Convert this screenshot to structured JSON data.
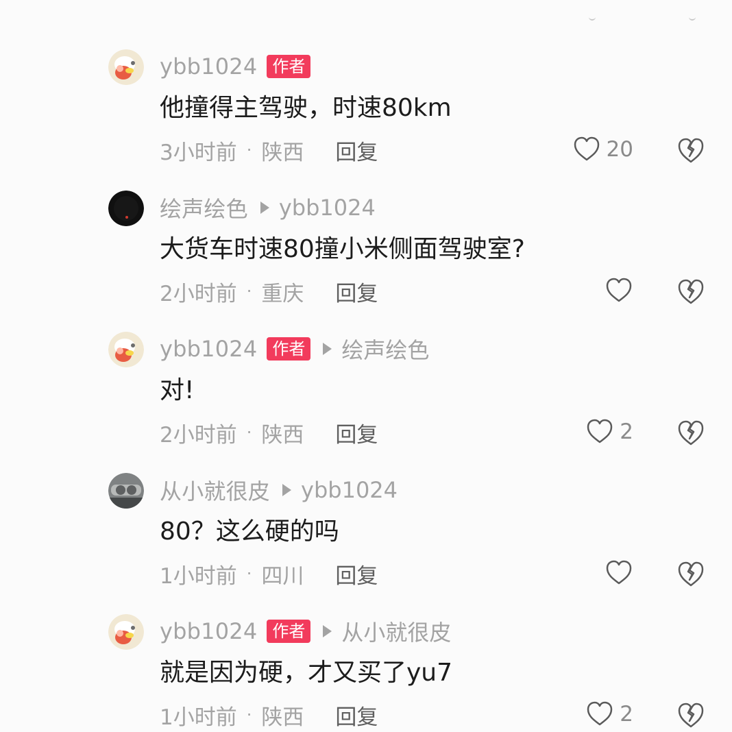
{
  "author_badge": "作者",
  "reply_label": "回复",
  "comments": [
    {
      "username": "ybb1024",
      "is_author": true,
      "reply_to": "",
      "text": "他撞得主驾驶，时速80km",
      "time": "3小时前",
      "location": "陕西",
      "likes": "20",
      "avatar": "cartoon-avatar"
    },
    {
      "username": "绘声绘色",
      "is_author": false,
      "reply_to": "ybb1024",
      "text": "大货车时速80撞小米侧面驾驶室?",
      "time": "2小时前",
      "location": "重庆",
      "likes": "",
      "avatar": "dark-avatar"
    },
    {
      "username": "ybb1024",
      "is_author": true,
      "reply_to": "绘声绘色",
      "text": "对!",
      "time": "2小时前",
      "location": "陕西",
      "likes": "2",
      "avatar": "cartoon-avatar"
    },
    {
      "username": "从小就很皮",
      "is_author": false,
      "reply_to": "ybb1024",
      "text": "80？这么硬的吗",
      "time": "1小时前",
      "location": "四川",
      "likes": "",
      "avatar": "gray-avatar"
    },
    {
      "username": "ybb1024",
      "is_author": true,
      "reply_to": "从小就很皮",
      "text": "就是因为硬，才又买了yu7",
      "time": "1小时前",
      "location": "陕西",
      "likes": "2",
      "avatar": "cartoon-avatar"
    }
  ],
  "colors": {
    "author_badge": "#f23b5c",
    "muted_text": "#a3a3a3",
    "main_text": "#1c1c1c",
    "reply_text": "#5f5f5f"
  }
}
